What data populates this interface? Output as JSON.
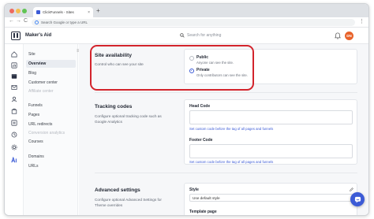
{
  "browser": {
    "tab_title": "ClickFunnels - Sites",
    "tab_close": "×",
    "new_tab": "+",
    "address_placeholder": "Search Google or type a URL",
    "nav_back": "←",
    "nav_forward": "→",
    "nav_reload": "C",
    "menu": "⋮"
  },
  "header": {
    "brand": "Maker's Aid",
    "search_placeholder": "Search for anything",
    "avatar_initials": "DN",
    "avatar_color": "#e8622a"
  },
  "sidebar": {
    "collapse_glyph": "≡",
    "items": [
      {
        "label": "Site",
        "active": false,
        "muted": false
      },
      {
        "label": "Overview",
        "active": true,
        "muted": false
      },
      {
        "label": "Blog",
        "active": false,
        "muted": false
      },
      {
        "label": "Customer center",
        "active": false,
        "muted": false
      },
      {
        "label": "Affiliate center",
        "active": false,
        "muted": true
      },
      {
        "label": "Funnels",
        "active": false,
        "muted": false
      },
      {
        "label": "Pages",
        "active": false,
        "muted": false
      },
      {
        "label": "URL redirects",
        "active": false,
        "muted": false
      },
      {
        "label": "Conversion analytics",
        "active": false,
        "muted": true
      },
      {
        "label": "Courses",
        "active": false,
        "muted": false
      },
      {
        "label": "Domains",
        "active": false,
        "muted": false
      },
      {
        "label": "URLs",
        "active": false,
        "muted": false
      }
    ]
  },
  "site_availability": {
    "title": "Site availability",
    "description": "Control who can see your site",
    "options": [
      {
        "label": "Public",
        "description": "Anyone can see the site.",
        "selected": false
      },
      {
        "label": "Private",
        "description": "Only contributors can see the site.",
        "selected": true
      }
    ]
  },
  "tracking_codes": {
    "title": "Tracking codes",
    "description": "Configure optional tracking code such as Google Analytics",
    "head_label": "Head Code",
    "head_help": "Set custom code before the tag of all pages and funnels",
    "footer_label": "Footer Code",
    "footer_help": "Set custom code before the tag of all pages and funnels"
  },
  "advanced_settings": {
    "title": "Advanced settings",
    "description": "Configure optional Advanced Settings for Theme overrides",
    "style_label": "Style",
    "style_value": "Use default style",
    "template_label": "Template page"
  },
  "colors": {
    "accent": "#3c5bd6",
    "highlight": "#d3242c"
  }
}
